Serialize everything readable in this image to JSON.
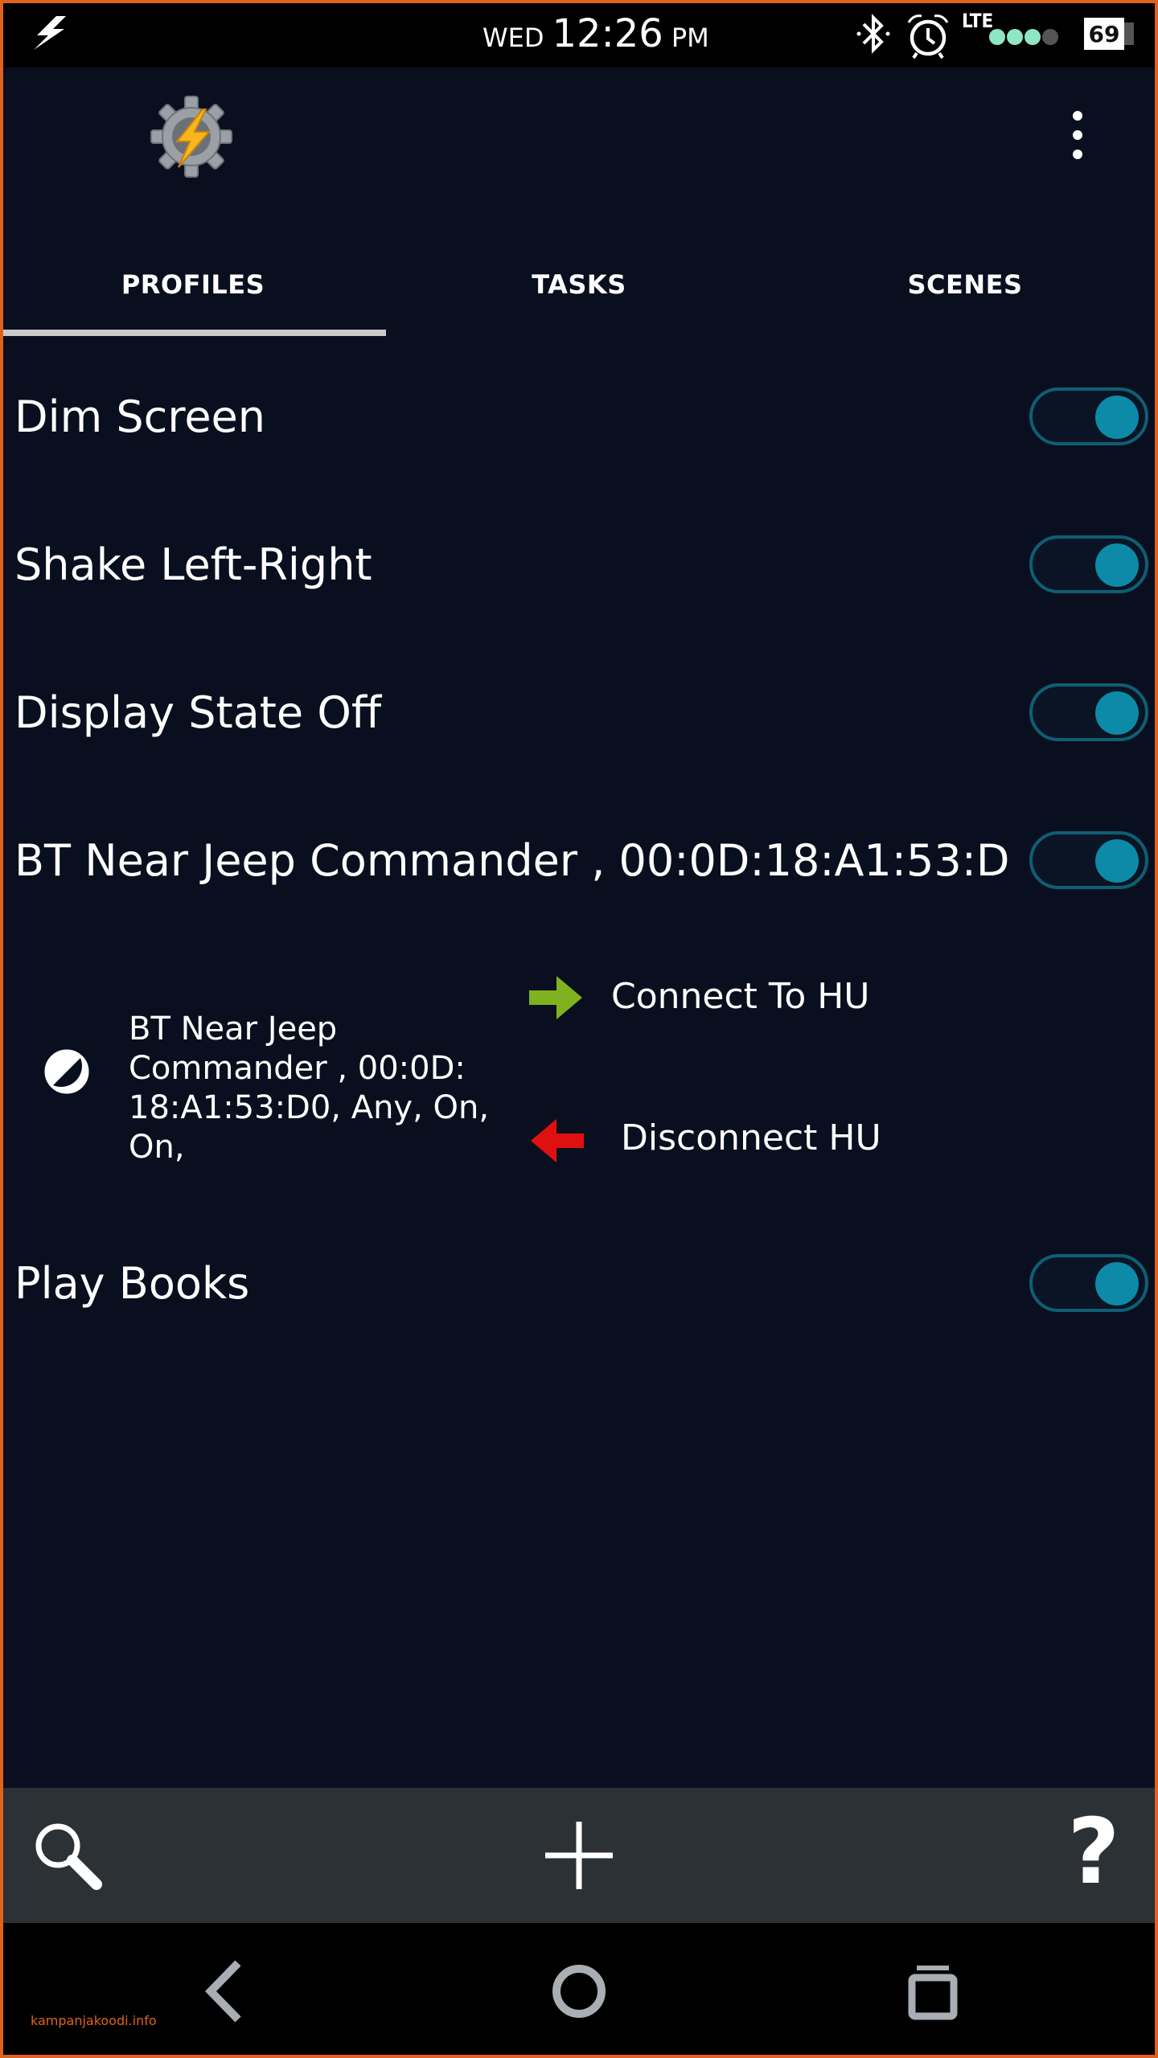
{
  "status_bar": {
    "day": "WED",
    "time": "12:26",
    "ampm": "PM",
    "network": "LTE",
    "battery": "69"
  },
  "tabs": [
    {
      "label": "PROFILES",
      "active": true
    },
    {
      "label": "TASKS",
      "active": false
    },
    {
      "label": "SCENES",
      "active": false
    }
  ],
  "profiles": [
    {
      "name": "Dim Screen",
      "enabled": true
    },
    {
      "name": "Shake Left-Right",
      "enabled": true
    },
    {
      "name": "Display State Off",
      "enabled": true
    },
    {
      "name": "BT Near Jeep Commander , 00:0D:18:A1:53:D0, Any, On, On,",
      "enabled": true
    },
    {
      "name": "Play Books",
      "enabled": true
    }
  ],
  "expanded_profile": {
    "context_lines": [
      "BT Near Jeep",
      "Commander , 00:0D:",
      "18:A1:53:D0, Any, On, On,"
    ],
    "enter_task": "Connect To HU",
    "exit_task": "Disconnect HU"
  },
  "icons": {
    "status_left": "flash-icon",
    "bluetooth": "bluetooth-icon",
    "alarm": "alarm-icon",
    "app_logo": "tasker-gear-bolt-icon",
    "overflow": "overflow-menu-icon",
    "search": "search-icon",
    "add": "add-icon",
    "help": "help-icon",
    "back": "back-icon",
    "home": "home-icon",
    "recent": "recent-apps-icon"
  },
  "colors": {
    "background": "#0a0f1f",
    "toggle_on": "#0d8aa8",
    "enter_arrow": "#7fb21e",
    "exit_arrow": "#e01010",
    "toolbar": "#2c3136",
    "frame": "#e0621c"
  },
  "bottom_bar": {
    "help_label": "?"
  },
  "watermark": "kampanjakoodi.info"
}
